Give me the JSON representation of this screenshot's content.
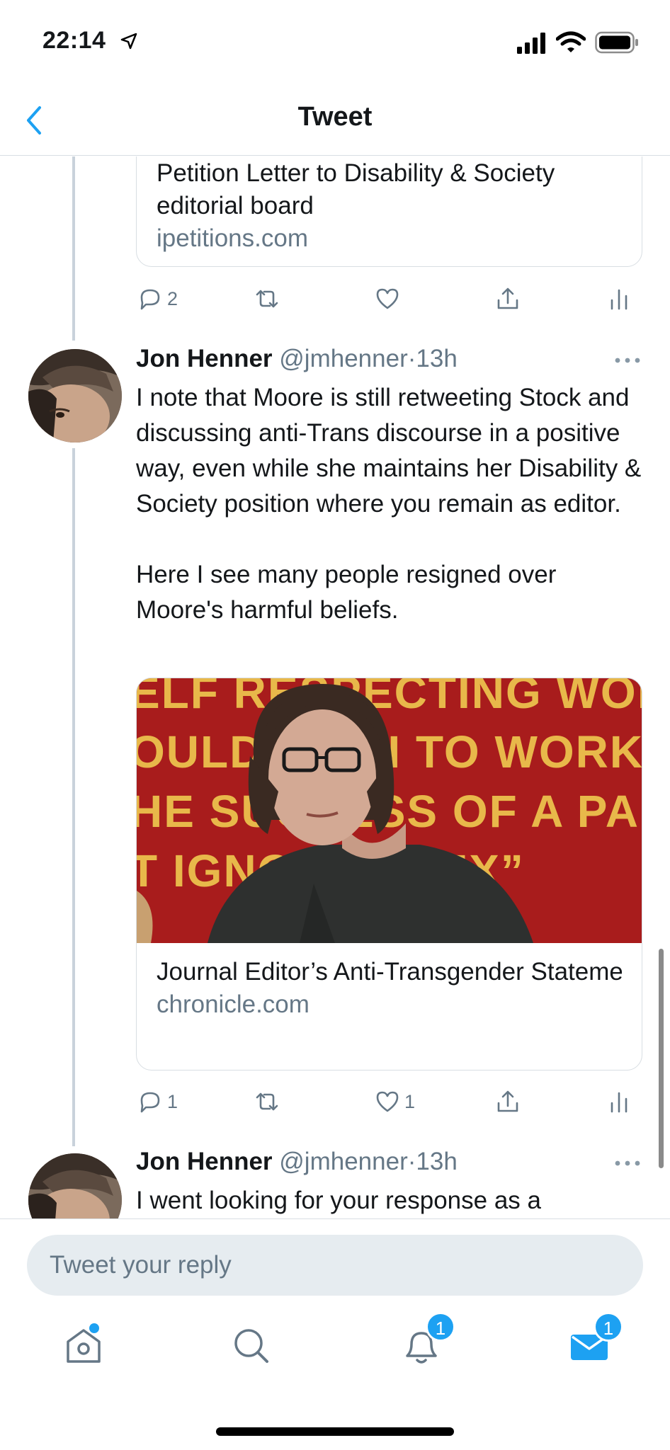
{
  "status": {
    "time": "22:14"
  },
  "header": {
    "title": "Tweet"
  },
  "link_card_1": {
    "title": "Petition Letter to Disability & Society editorial board",
    "domain": "ipetitions.com"
  },
  "actions_1": {
    "replies": "2",
    "retweets": "",
    "likes": ""
  },
  "tweet_1": {
    "name": "Jon Henner",
    "handle": "@jmhenner",
    "sep": "·",
    "time": "13h",
    "text_p1": "I note that Moore is still retweeting Stock and discussing anti-Trans discourse in a positive way, even while she maintains her Disability & Society position where you remain as editor.",
    "text_p2": "Here I see many people resigned over Moore's harmful beliefs."
  },
  "link_card_2": {
    "image_banner_lines": [
      "ELF RESPECTING WOMAN",
      "OULD WISH TO WORK",
      "HE SUCCESS OF A PARTY",
      "T IGNORES SEX”"
    ],
    "title": "Journal Editor’s Anti-Transgender Statements Spur a Revolt by Disabil…",
    "domain": "chronicle.com"
  },
  "actions_2": {
    "replies": "1",
    "retweets": "",
    "likes": "1"
  },
  "tweet_2": {
    "name": "Jon Henner",
    "handle": "@jmhenner",
    "sep": "·",
    "time": "13h",
    "text": "I went looking for your response as a"
  },
  "reply": {
    "placeholder": "Tweet your reply"
  },
  "tabs": {
    "notifications_badge": "1",
    "messages_badge": "1"
  },
  "colors": {
    "accent": "#1da1f2",
    "secondary_text": "#657786",
    "banner_red": "#a81c1c",
    "banner_text": "#e8b84a"
  }
}
